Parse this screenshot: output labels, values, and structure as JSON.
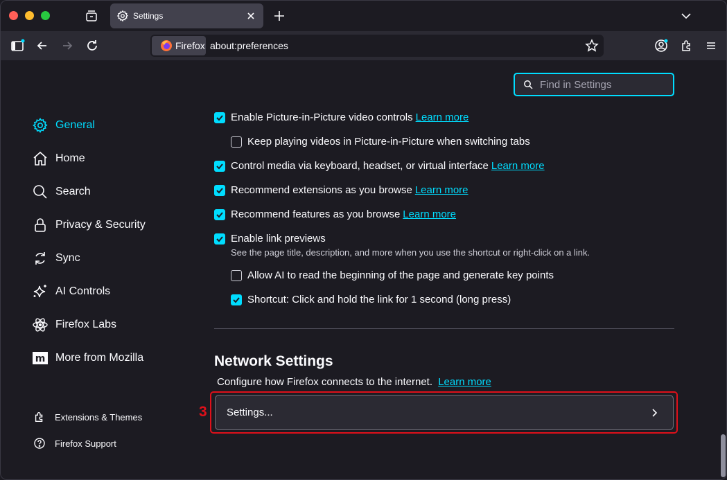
{
  "tab": {
    "title": "Settings"
  },
  "urlbar": {
    "identity_label": "Firefox",
    "url": "about:preferences"
  },
  "search": {
    "placeholder": "Find in Settings"
  },
  "nav": {
    "items": [
      {
        "label": "General",
        "icon": "gear-icon",
        "selected": true
      },
      {
        "label": "Home",
        "icon": "home-icon"
      },
      {
        "label": "Search",
        "icon": "search-icon"
      },
      {
        "label": "Privacy & Security",
        "icon": "lock-icon"
      },
      {
        "label": "Sync",
        "icon": "sync-icon"
      },
      {
        "label": "AI Controls",
        "icon": "sparkle-icon"
      },
      {
        "label": "Firefox Labs",
        "icon": "atom-icon"
      },
      {
        "label": "More from Mozilla",
        "icon": "mozilla-icon"
      }
    ],
    "footer": [
      {
        "label": "Extensions & Themes",
        "icon": "puzzle-icon"
      },
      {
        "label": "Firefox Support",
        "icon": "help-icon"
      }
    ]
  },
  "options": {
    "pip_controls": {
      "label": "Enable Picture-in-Picture video controls",
      "link": "Learn more",
      "checked": true
    },
    "pip_keep_playing": {
      "label": "Keep playing videos in Picture-in-Picture when switching tabs",
      "checked": false
    },
    "media_control": {
      "label": "Control media via keyboard, headset, or virtual interface",
      "link": "Learn more",
      "checked": true
    },
    "recommend_extensions": {
      "label": "Recommend extensions as you browse",
      "link": "Learn more",
      "checked": true
    },
    "recommend_features": {
      "label": "Recommend features as you browse",
      "link": "Learn more",
      "checked": true
    },
    "link_previews": {
      "label": "Enable link previews",
      "hint": "See the page title, description, and more when you use the shortcut or right-click on a link.",
      "checked": true
    },
    "ai_key_points": {
      "label": "Allow AI to read the beginning of the page and generate key points",
      "checked": false
    },
    "shortcut_long_press": {
      "label": "Shortcut: Click and hold the link for 1 second (long press)",
      "checked": true
    }
  },
  "network": {
    "title": "Network Settings",
    "description": "Configure how Firefox connects to the internet.",
    "link": "Learn more",
    "button_label": "Settings..."
  },
  "annotation": {
    "number": "3",
    "color": "#e0101a"
  },
  "colors": {
    "accent": "#00ddff",
    "background": "#1c1b22",
    "toolbar": "#2b2a33"
  }
}
